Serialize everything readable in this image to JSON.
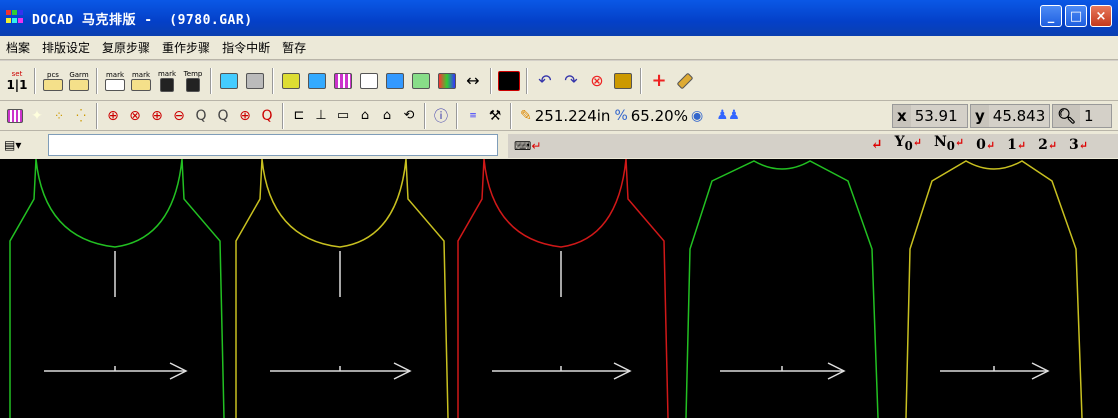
{
  "window": {
    "title": "DOCAD 马克排版 -  (9780.GAR)",
    "controls": [
      "_",
      "□",
      "×"
    ]
  },
  "menu": {
    "items": [
      "档案",
      "排版设定",
      "复原步骤",
      "重作步骤",
      "指令中断",
      "暂存"
    ]
  },
  "toolbar1": {
    "labels": [
      "set",
      "pcs",
      "Garm",
      "mark",
      "mark",
      "mark",
      "Temp"
    ]
  },
  "toolbar2": {
    "length": "251.224in",
    "efficiency": "65.20%",
    "x_label": "x",
    "x_value": "53.91",
    "y_label": "y",
    "y_value": "45.843",
    "zoom_value": "1"
  },
  "toolbar3": {
    "flags": [
      {
        "letter": "Y",
        "sub": "0"
      },
      {
        "letter": "N",
        "sub": "0"
      },
      {
        "letter": "0",
        "sub": ""
      },
      {
        "letter": "1",
        "sub": ""
      },
      {
        "letter": "2",
        "sub": ""
      },
      {
        "letter": "3",
        "sub": ""
      }
    ]
  },
  "canvas": {
    "background": "#000000",
    "pieces": [
      {
        "color": "#22c022",
        "neck": "scoop"
      },
      {
        "color": "#c8c020",
        "neck": "scoop"
      },
      {
        "color": "#d01818",
        "neck": "scoop"
      },
      {
        "color": "#22c022",
        "neck": "shallow"
      },
      {
        "color": "#c8c020",
        "neck": "shallow"
      }
    ]
  }
}
